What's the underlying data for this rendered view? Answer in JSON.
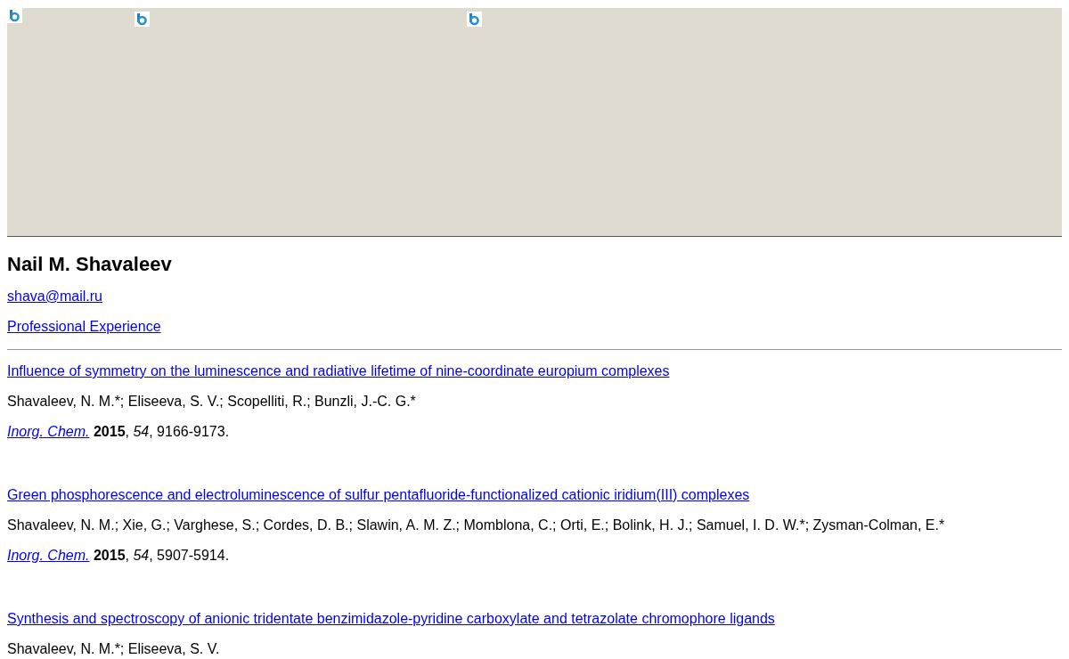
{
  "banner": {
    "kind": "picture"
  },
  "name": "Nail M. Shavaleev",
  "links": [
    "shava@mail.ru",
    "Professional Experience"
  ],
  "publications": [
    {
      "title": "Influence of symmetry on the luminescence and radiative lifetime of nine-coordinate europium complexes",
      "authors": "Shavaleev, N. M.*; Eliseeva, S. V.; Scopelliti, R.; Bunzli, J.-C. G.*",
      "journal": "Inorg. Chem.",
      "details": "**2015**, *54*, 9166-9173."
    },
    {
      "title": "Green phosphorescence and electroluminescence of sulfur pentafluoride-functionalized cationic iridium(III) complexes",
      "authors": "Shavaleev, N. M.; Xie, G.; Varghese, S.; Cordes, D. B.; Slawin, A. M. Z.; Momblona, C.; Orti, E.; Bolink, H. J.; Samuel, I. D. W.*; Zysman-Colman, E.*",
      "journal": "Inorg. Chem.",
      "details": "**2015**, *54*, 5907-5914."
    },
    {
      "title": "Synthesis and spectroscopy of anionic tridentate benzimidazole-pyridine carboxylate and tetrazolate chromophore ligands",
      "authors": "Shavaleev, N. M.*; Eliseeva, S. V."
    }
  ]
}
